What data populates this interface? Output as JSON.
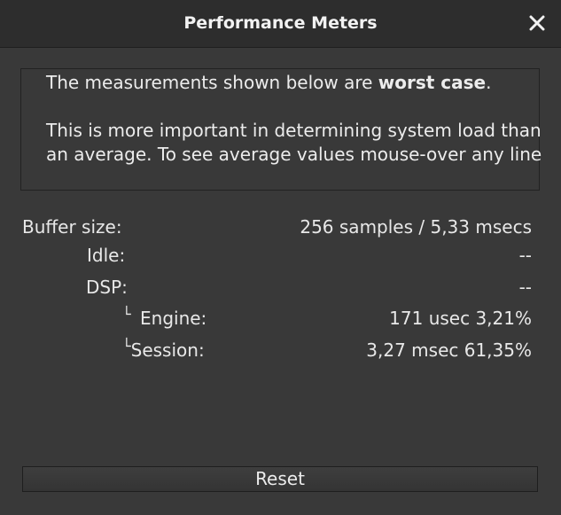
{
  "window": {
    "title": "Performance Meters"
  },
  "info": {
    "line1_prefix": "The measurements shown below are ",
    "line1_bold": "worst case",
    "line1_suffix": ".",
    "paragraph2": "This is more important in determining system load than an average. To see average values mouse-over any line"
  },
  "stats": {
    "buffer_label": "Buffer size:",
    "buffer_value": "256 samples /  5,33 msecs",
    "idle_label": "Idle:",
    "idle_value": "--",
    "dsp_label": "DSP:",
    "dsp_value": "--",
    "engine_label": "Engine:",
    "engine_value": "171 usec  3,21%",
    "session_label": "Session:",
    "session_value": "3,27 msec 61,35%",
    "tree_glyph": "└"
  },
  "actions": {
    "reset_label": "Reset"
  },
  "icons": {
    "close": "close-icon"
  }
}
